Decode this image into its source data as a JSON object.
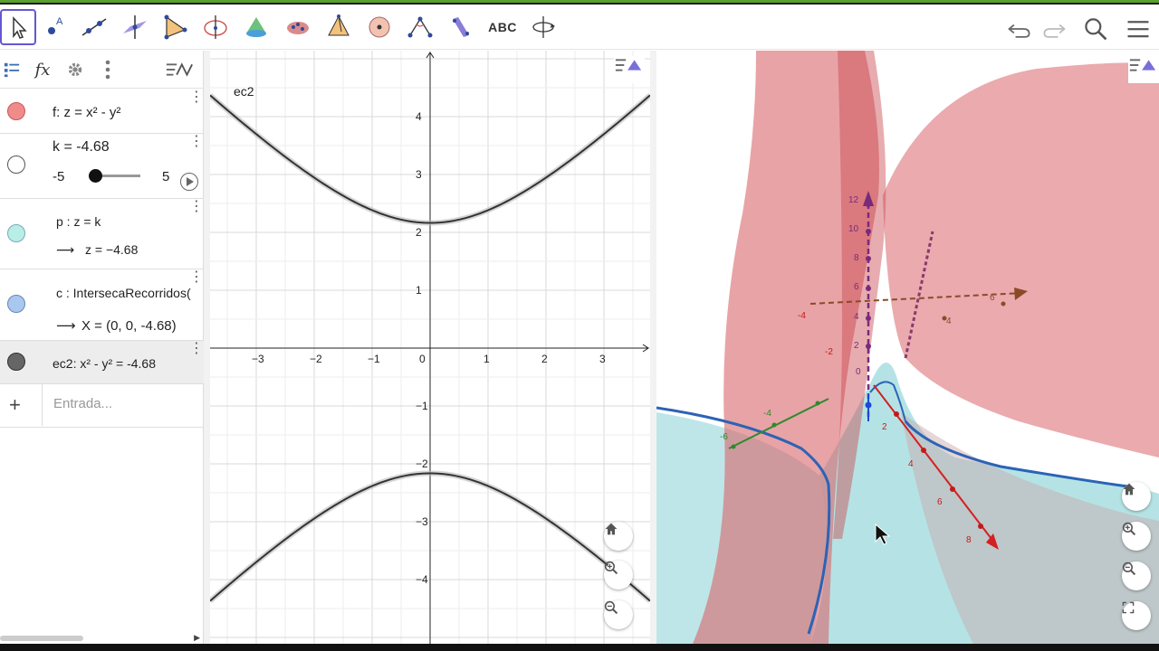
{
  "toolbar": {
    "tools": [
      {
        "name": "move-tool-icon",
        "active": true
      },
      {
        "name": "point-tool-icon"
      },
      {
        "name": "line-tool-icon"
      },
      {
        "name": "perpendicular-plane-tool-icon"
      },
      {
        "name": "polygon-tool-icon"
      },
      {
        "name": "circle-tool-icon"
      },
      {
        "name": "intersect-surfaces-tool-icon"
      },
      {
        "name": "sphere-tool-icon"
      },
      {
        "name": "pyramid-tool-icon"
      },
      {
        "name": "rotate-around-point-tool-icon"
      },
      {
        "name": "angle-tool-icon"
      },
      {
        "name": "reflect-tool-icon"
      },
      {
        "name": "text-tool-icon",
        "label": "ABC"
      },
      {
        "name": "rotate-view-tool-icon"
      }
    ],
    "undo": "undo-icon",
    "redo": "redo-icon",
    "search": "search-icon",
    "menu": "menu-icon"
  },
  "algebra": {
    "header_icons": [
      "algebra-view-icon",
      "fx-icon",
      "settings-icon",
      "more-icon",
      "graph-toggle-icon"
    ],
    "rows": [
      {
        "text": "f: z = x² - y²",
        "color": "#f08b8b"
      },
      {
        "text": "k = -4.68",
        "slider_min": "-5",
        "slider_max": "5",
        "slider_value": 0.032,
        "color": "#ffffff"
      },
      {
        "text": "p : z = k",
        "result": "z = −4.68",
        "color": "#b9eee7"
      },
      {
        "text": "c : IntersecaRecorridos(",
        "result": "X = (0, 0, -4.68)",
        "color": "#a9c8ef"
      },
      {
        "text": "ec2: x² - y² = -4.68",
        "color": "#666666"
      }
    ],
    "input_placeholder": "Entrada...",
    "plus": "+"
  },
  "graphics2d": {
    "label": "ec2",
    "x_ticks": [
      "−3",
      "−2",
      "−1",
      "0",
      "1",
      "2",
      "3"
    ],
    "y_ticks": [
      "4",
      "3",
      "2",
      "1",
      "−1",
      "−2",
      "−3",
      "−4"
    ],
    "constant": -4.68
  },
  "graphics3d": {
    "z_ticks": [
      "12",
      "10",
      "8",
      "6",
      "4",
      "2",
      "0",
      "-2"
    ],
    "x_ticks": [
      "2",
      "4",
      "6",
      "8"
    ],
    "y_ticks": [
      "-4",
      "-2",
      "2",
      "4",
      "6"
    ],
    "green_ticks": [
      "-2",
      "-4",
      "-6"
    ]
  },
  "colors": {
    "accent": "#6557d2",
    "surface_red": "#d9656b",
    "plane_cyan": "#a8dee0",
    "curve_blue": "#2c63b5"
  }
}
